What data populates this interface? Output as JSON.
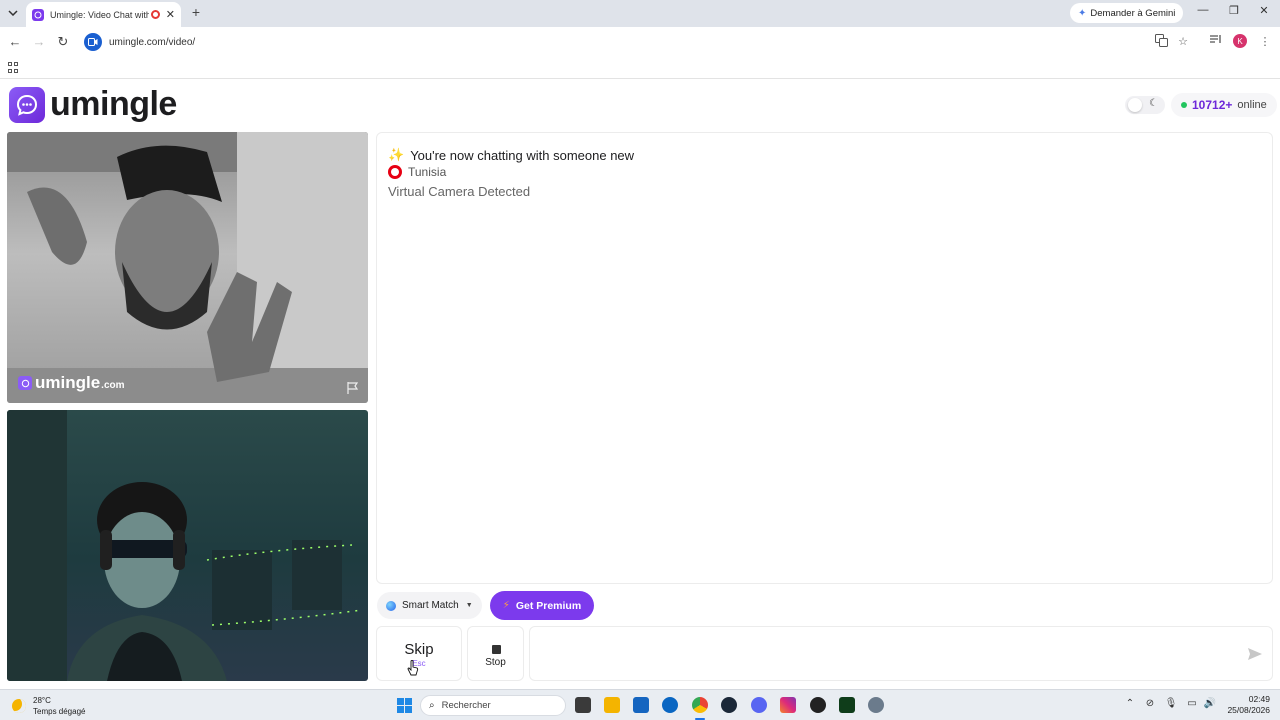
{
  "browser": {
    "tab_title": "Umingle: Video Chat with S",
    "gemini_label": "Demander à Gemini",
    "url": "umingle.com/video/",
    "profile_initial": "K"
  },
  "site": {
    "logo_text": "umingle",
    "online_count": "10712+",
    "online_label": "online"
  },
  "stranger_video": {
    "watermark_text": "umingle",
    "watermark_domain": ".com"
  },
  "chat": {
    "status_message": "You're now chatting with someone new",
    "country": "Tunisia",
    "notice": "Virtual Camera Detected",
    "message_placeholder": ""
  },
  "controls": {
    "smart_match_label": "Smart Match",
    "premium_label": "Get Premium",
    "skip_label": "Skip",
    "skip_shortcut": "Esc",
    "stop_label": "Stop"
  },
  "taskbar": {
    "temperature": "28°C",
    "weather": "Temps dégagé",
    "search_placeholder": "Rechercher",
    "time": "02:49",
    "date": "25/08/2026"
  },
  "colors": {
    "brand_purple": "#7c3aed",
    "online_green": "#22c55e"
  }
}
